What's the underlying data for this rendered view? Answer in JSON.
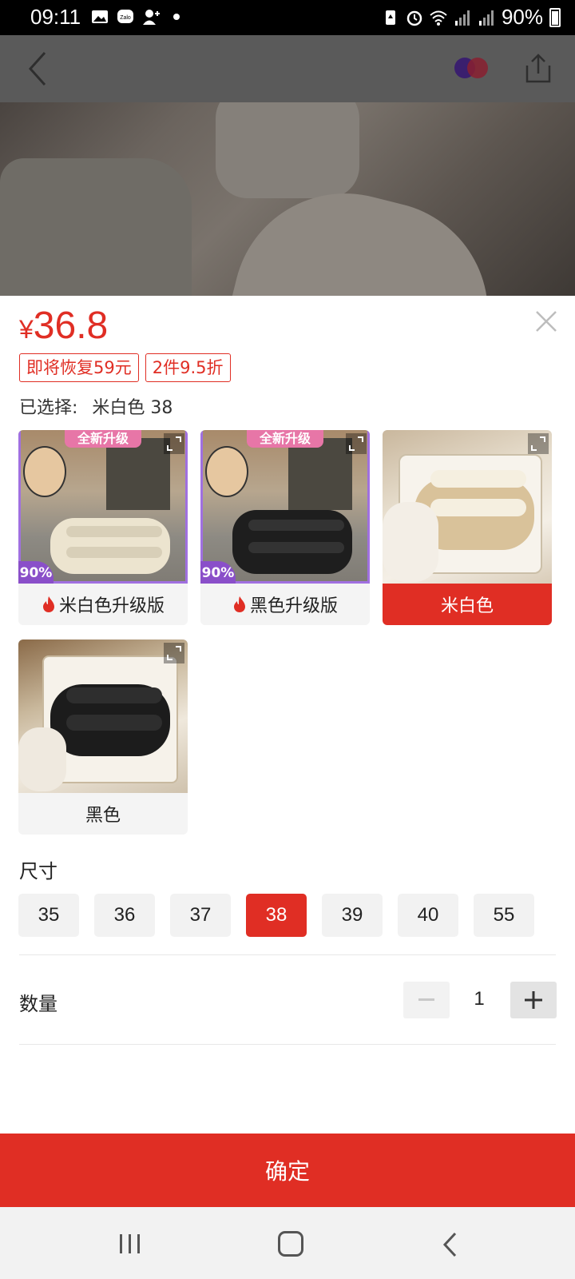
{
  "status_bar": {
    "time": "09:11",
    "battery": "90%",
    "icons": [
      "image-icon",
      "zalo-icon",
      "add-contact-icon",
      "dot-icon",
      "battery-saver-icon",
      "alarm-icon",
      "wifi-icon",
      "signal-icon",
      "signal-icon",
      "battery-icon"
    ]
  },
  "product": {
    "price_currency": "¥",
    "price_value": "36.8",
    "tags": [
      "即将恢复59元",
      "2件9.5折"
    ],
    "selected_label": "已选择:",
    "selected_value": "米白色 38"
  },
  "variants": [
    {
      "label": "米白色升级版",
      "hot": true,
      "badge": "全新升级",
      "percent": "90%",
      "active": false
    },
    {
      "label": "黑色升级版",
      "hot": true,
      "badge": "全新升级",
      "percent": "90%",
      "active": false
    },
    {
      "label": "米白色",
      "hot": false,
      "active": true
    },
    {
      "label": "黑色",
      "hot": false,
      "active": false
    }
  ],
  "size": {
    "title": "尺寸",
    "options": [
      "35",
      "36",
      "37",
      "38",
      "39",
      "40",
      "55"
    ],
    "selected": "38"
  },
  "quantity": {
    "title": "数量",
    "value": "1"
  },
  "confirm_label": "确定",
  "colors": {
    "accent": "#e02e24",
    "overlay": "#5a5a5a"
  }
}
